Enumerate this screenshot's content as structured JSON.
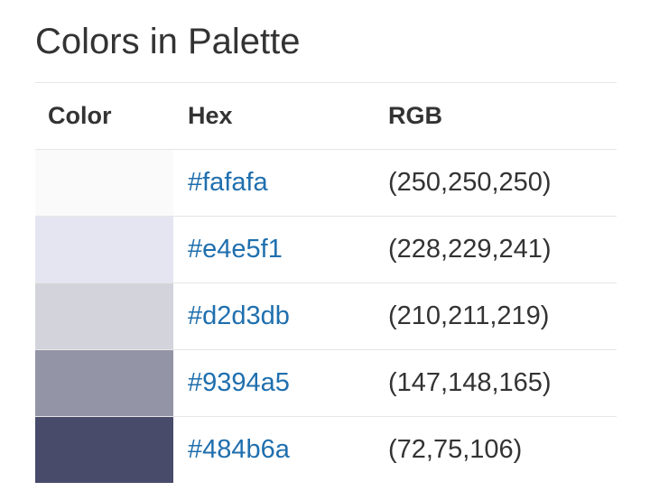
{
  "title": "Colors in Palette",
  "table": {
    "headers": {
      "color": "Color",
      "hex": "Hex",
      "rgb": "RGB"
    },
    "rows": [
      {
        "swatch": "#fafafa",
        "hex": "#fafafa",
        "rgb": "(250,250,250)"
      },
      {
        "swatch": "#e4e5f1",
        "hex": "#e4e5f1",
        "rgb": "(228,229,241)"
      },
      {
        "swatch": "#d2d3db",
        "hex": "#d2d3db",
        "rgb": "(210,211,219)"
      },
      {
        "swatch": "#9394a5",
        "hex": "#9394a5",
        "rgb": "(147,148,165)"
      },
      {
        "swatch": "#484b6a",
        "hex": "#484b6a",
        "rgb": "(72,75,106)"
      }
    ]
  },
  "colors": {
    "link": "#1f6fae",
    "text": "#333333",
    "divider": "#e6e6e6"
  }
}
